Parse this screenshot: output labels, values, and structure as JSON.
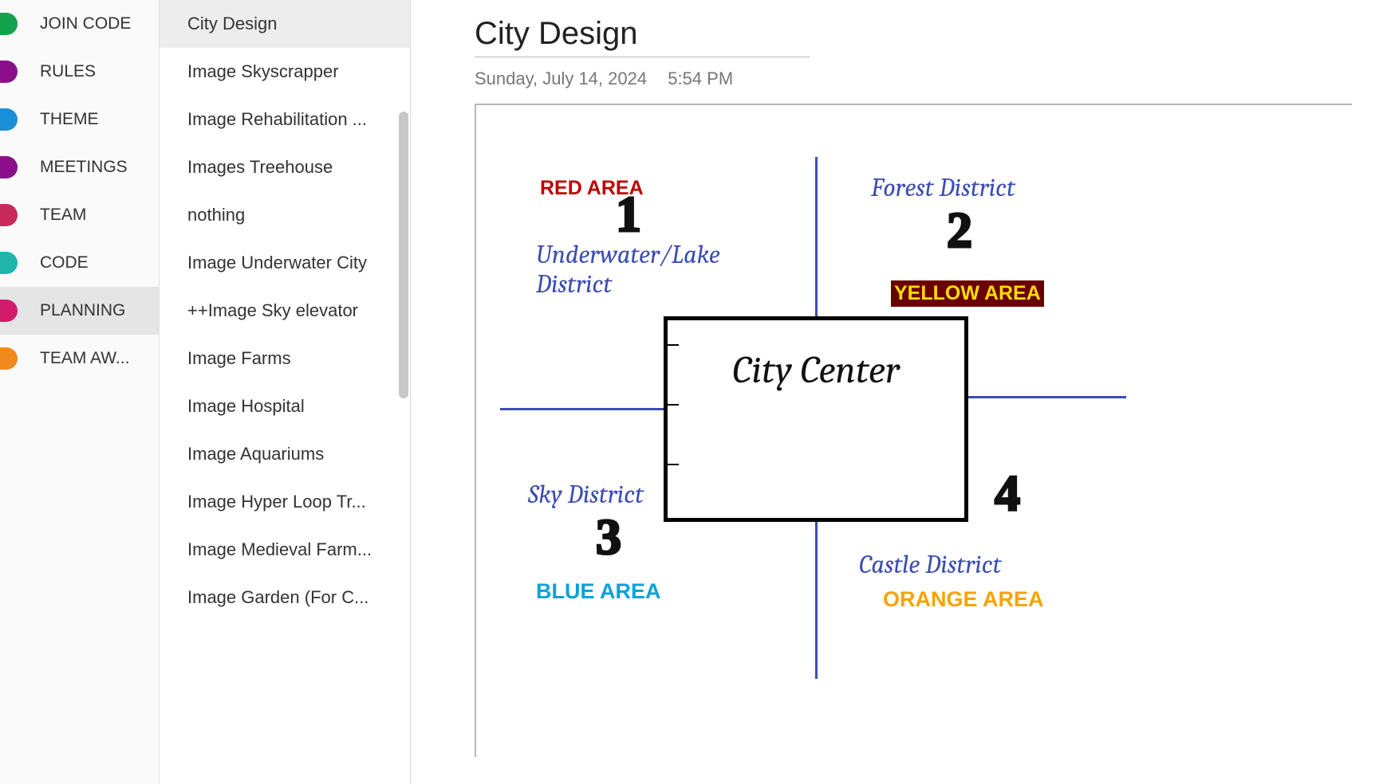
{
  "sections": [
    {
      "label": "JOIN CODE",
      "color": "#14a34a"
    },
    {
      "label": "RULES",
      "color": "#8b0f8a"
    },
    {
      "label": "THEME",
      "color": "#1a8fd8"
    },
    {
      "label": "MEETINGS",
      "color": "#8b0f8a"
    },
    {
      "label": "TEAM",
      "color": "#c82a5c"
    },
    {
      "label": "CODE",
      "color": "#1fb5ad"
    },
    {
      "label": "PLANNING",
      "color": "#d11c6b",
      "selected": true
    },
    {
      "label": "TEAM AW...",
      "color": "#f08a1d"
    }
  ],
  "pages": [
    {
      "label": "City Design",
      "selected": true
    },
    {
      "label": "Image Skyscrapper"
    },
    {
      "label": "Image Rehabilitation ..."
    },
    {
      "label": "Images Treehouse"
    },
    {
      "label": "nothing"
    },
    {
      "label": "Image Underwater City"
    },
    {
      "label": "++Image Sky elevator"
    },
    {
      "label": "Image Farms"
    },
    {
      "label": "Image Hospital"
    },
    {
      "label": "Image Aquariums"
    },
    {
      "label": "Image Hyper Loop Tr..."
    },
    {
      "label": "Image Medieval Farm..."
    },
    {
      "label": "Image Garden (For C..."
    }
  ],
  "page": {
    "title": "City Design",
    "date": "Sunday, July 14, 2024",
    "time": "5:54 PM"
  },
  "diagram": {
    "center": "City Center",
    "q1": {
      "area": "RED AREA",
      "district": "Underwater/Lake District",
      "num": "1"
    },
    "q2": {
      "area": "YELLOW AREA",
      "district": "Forest District",
      "num": "2"
    },
    "q3": {
      "area": "BLUE AREA",
      "district": "Sky District",
      "num": "3"
    },
    "q4": {
      "area": "ORANGE AREA",
      "district": "Castle District",
      "num": "4"
    }
  }
}
